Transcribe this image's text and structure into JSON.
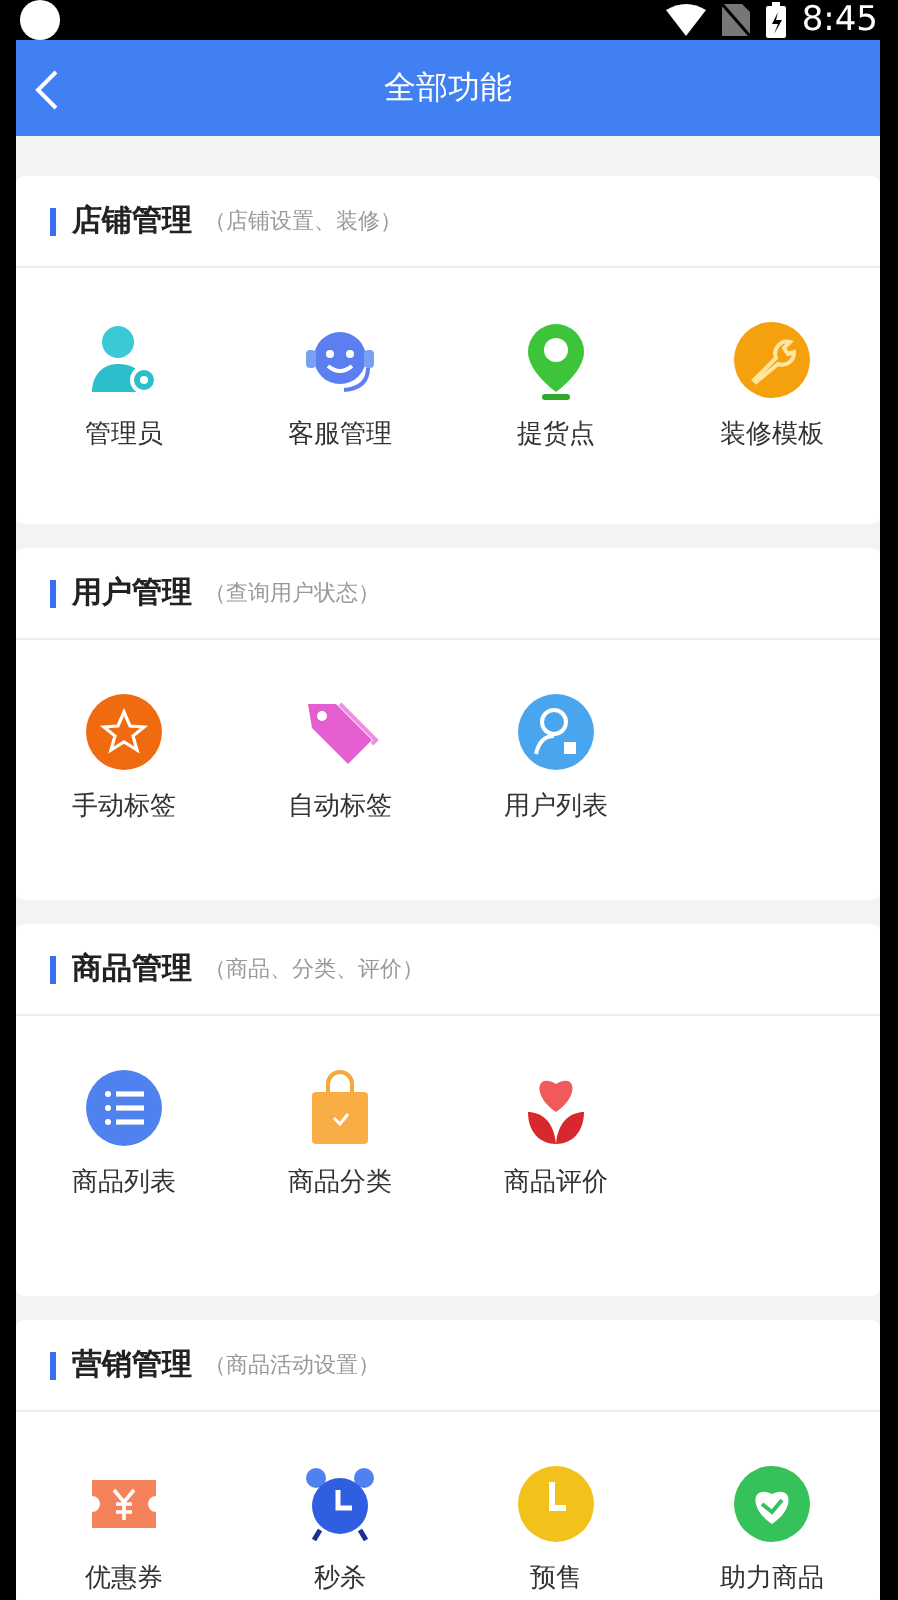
{
  "status_bar": {
    "time": "8:45"
  },
  "header": {
    "title": "全部功能"
  },
  "sections": [
    {
      "title": "店铺管理",
      "subtitle": "（店铺设置、装修）",
      "items": [
        {
          "label": "管理员"
        },
        {
          "label": "客服管理"
        },
        {
          "label": "提货点"
        },
        {
          "label": "装修模板"
        }
      ]
    },
    {
      "title": "用户管理",
      "subtitle": "（查询用户状态）",
      "items": [
        {
          "label": "手动标签"
        },
        {
          "label": "自动标签"
        },
        {
          "label": "用户列表"
        }
      ]
    },
    {
      "title": "商品管理",
      "subtitle": "（商品、分类、评价）",
      "items": [
        {
          "label": "商品列表"
        },
        {
          "label": "商品分类"
        },
        {
          "label": "商品评价"
        }
      ]
    },
    {
      "title": "营销管理",
      "subtitle": "（商品活动设置）",
      "items": [
        {
          "label": "优惠券"
        },
        {
          "label": "秒杀"
        },
        {
          "label": "预售"
        },
        {
          "label": "助力商品"
        }
      ]
    }
  ]
}
